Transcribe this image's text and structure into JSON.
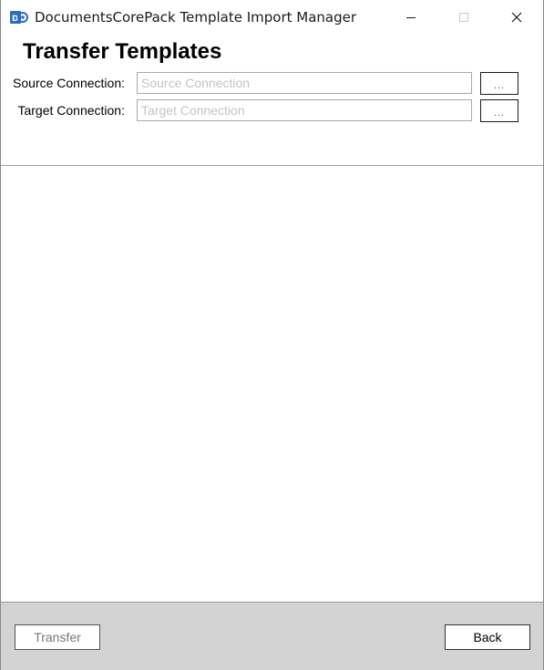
{
  "window": {
    "title": "DocumentsCorePack Template Import Manager"
  },
  "header": {
    "page_title": "Transfer Templates"
  },
  "connections": {
    "source": {
      "label": "Source Connection:",
      "value": "",
      "placeholder": "Source Connection",
      "browse_label": "..."
    },
    "target": {
      "label": "Target Connection:",
      "value": "",
      "placeholder": "Target Connection",
      "browse_label": "..."
    }
  },
  "footer": {
    "transfer_label": "Transfer",
    "back_label": "Back"
  },
  "icons": {
    "app": "app-logo-icon",
    "minimize": "minimize-icon",
    "maximize": "maximize-icon",
    "close": "close-icon"
  },
  "colors": {
    "app_icon_blue": "#2b6cc4",
    "footer_background": "#d3d3d3",
    "placeholder_text": "#c4c4c4"
  }
}
